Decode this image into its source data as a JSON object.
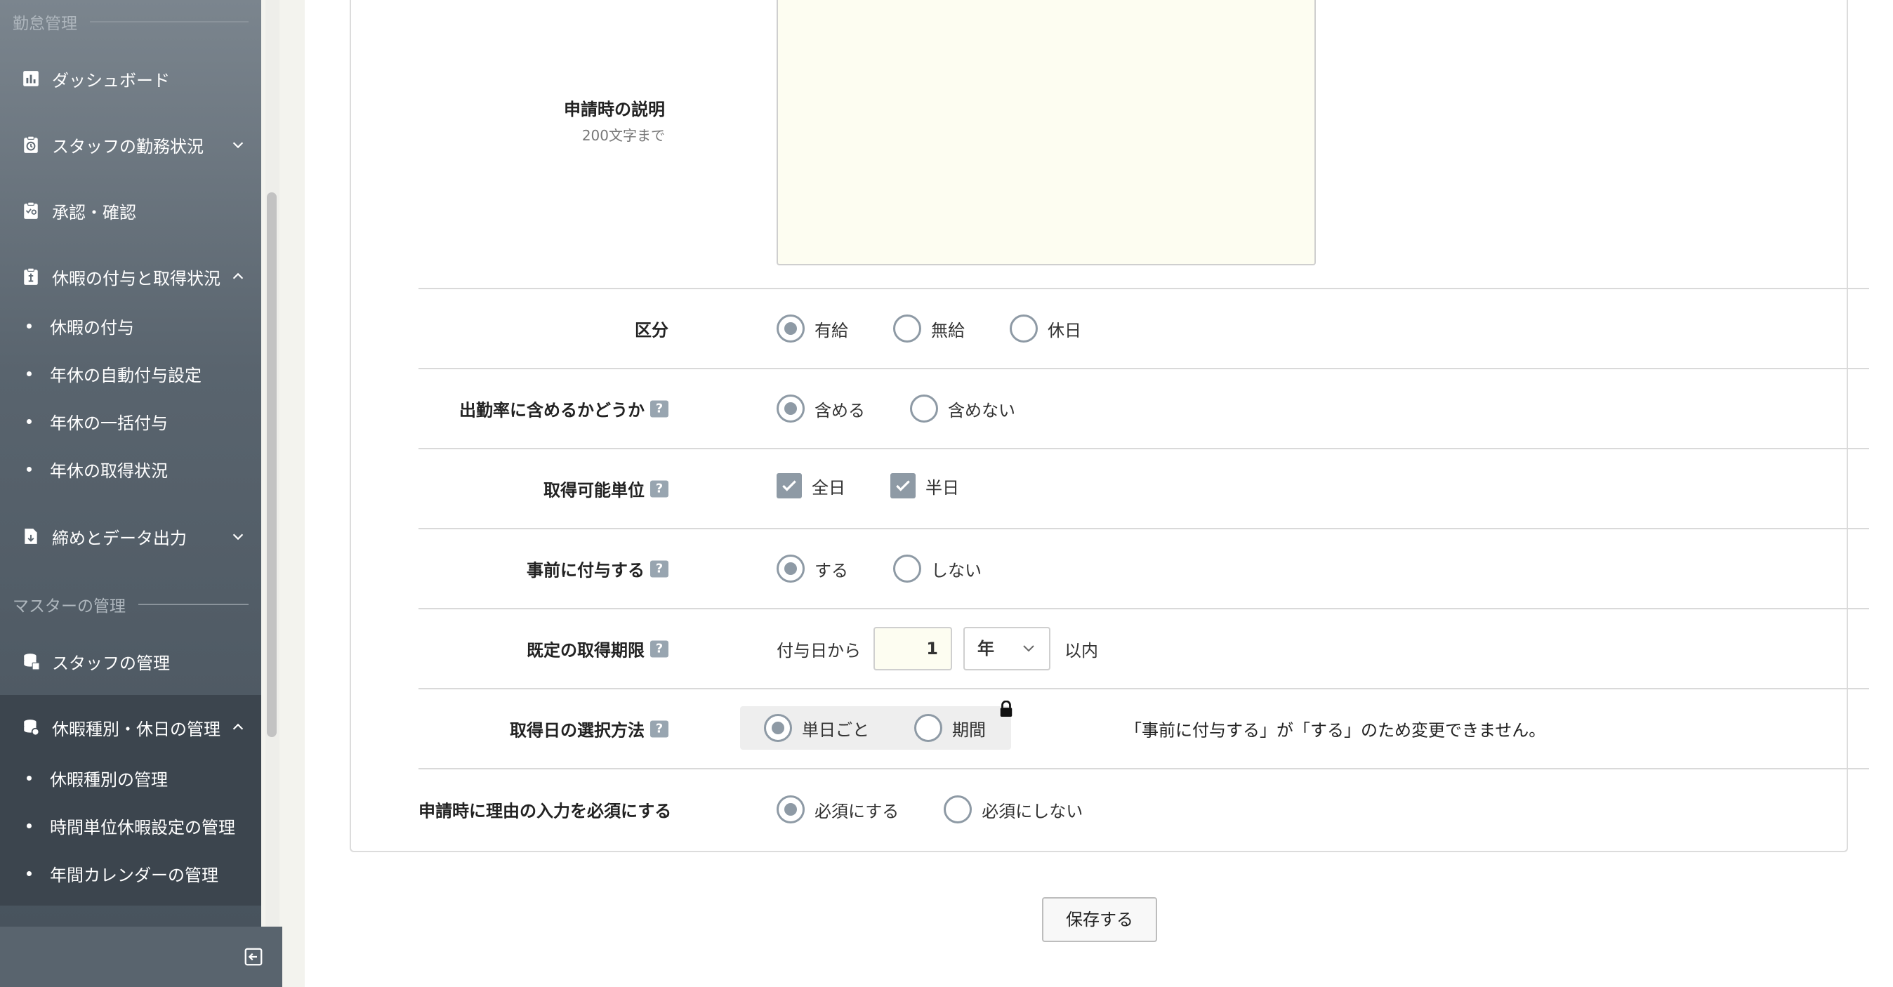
{
  "sidebar": {
    "section_attendance": "勤怠管理",
    "section_master": "マスターの管理",
    "items": [
      {
        "label": "ダッシュボード",
        "icon": "chart-icon"
      },
      {
        "label": "スタッフの勤務状況",
        "icon": "clock-clipboard-icon"
      },
      {
        "label": "承認・確認",
        "icon": "approval-icon"
      },
      {
        "label": "休暇の付与と取得状況",
        "icon": "leave-clipboard-icon"
      },
      {
        "label": "締めとデータ出力",
        "icon": "export-icon"
      },
      {
        "label": "スタッフの管理",
        "icon": "database-icon"
      },
      {
        "label": "休暇種別・休日の管理",
        "icon": "database-settings-icon"
      }
    ],
    "leave_sub": [
      "休暇の付与",
      "年休の自動付与設定",
      "年休の一括付与",
      "年休の取得状況"
    ],
    "master_sub": [
      "休暇種別の管理",
      "時間単位休暇設定の管理",
      "年間カレンダーの管理"
    ]
  },
  "form": {
    "description": {
      "label": "申請時の説明",
      "hint": "200文字まで",
      "value": ""
    },
    "category": {
      "label": "区分",
      "options": [
        "有給",
        "無給",
        "休日"
      ],
      "selected": "有給"
    },
    "attendance_rate": {
      "label": "出勤率に含めるかどうか",
      "options": [
        "含める",
        "含めない"
      ],
      "selected": "含める"
    },
    "units": {
      "label": "取得可能単位",
      "options": [
        "全日",
        "半日"
      ],
      "checked": [
        "全日",
        "半日"
      ]
    },
    "advance_grant": {
      "label": "事前に付与する",
      "options": [
        "する",
        "しない"
      ],
      "selected": "する"
    },
    "default_period": {
      "label": "既定の取得期限",
      "prefix": "付与日から",
      "value": "1",
      "unit": "年",
      "suffix": "以内"
    },
    "date_method": {
      "label": "取得日の選択方法",
      "options": [
        "単日ごと",
        "期間"
      ],
      "selected": "単日ごと",
      "locked_note": "「事前に付与する」が「する」のため変更できません。"
    },
    "reason_required": {
      "label": "申請時に理由の入力を必須にする",
      "options": [
        "必須にする",
        "必須にしない"
      ],
      "selected": "必須にする"
    }
  },
  "actions": {
    "save_label": "保存する"
  },
  "colors": {
    "sidebar": "#59646e",
    "accent": "#8e9aa5",
    "input_bg": "#fdfdf1"
  }
}
